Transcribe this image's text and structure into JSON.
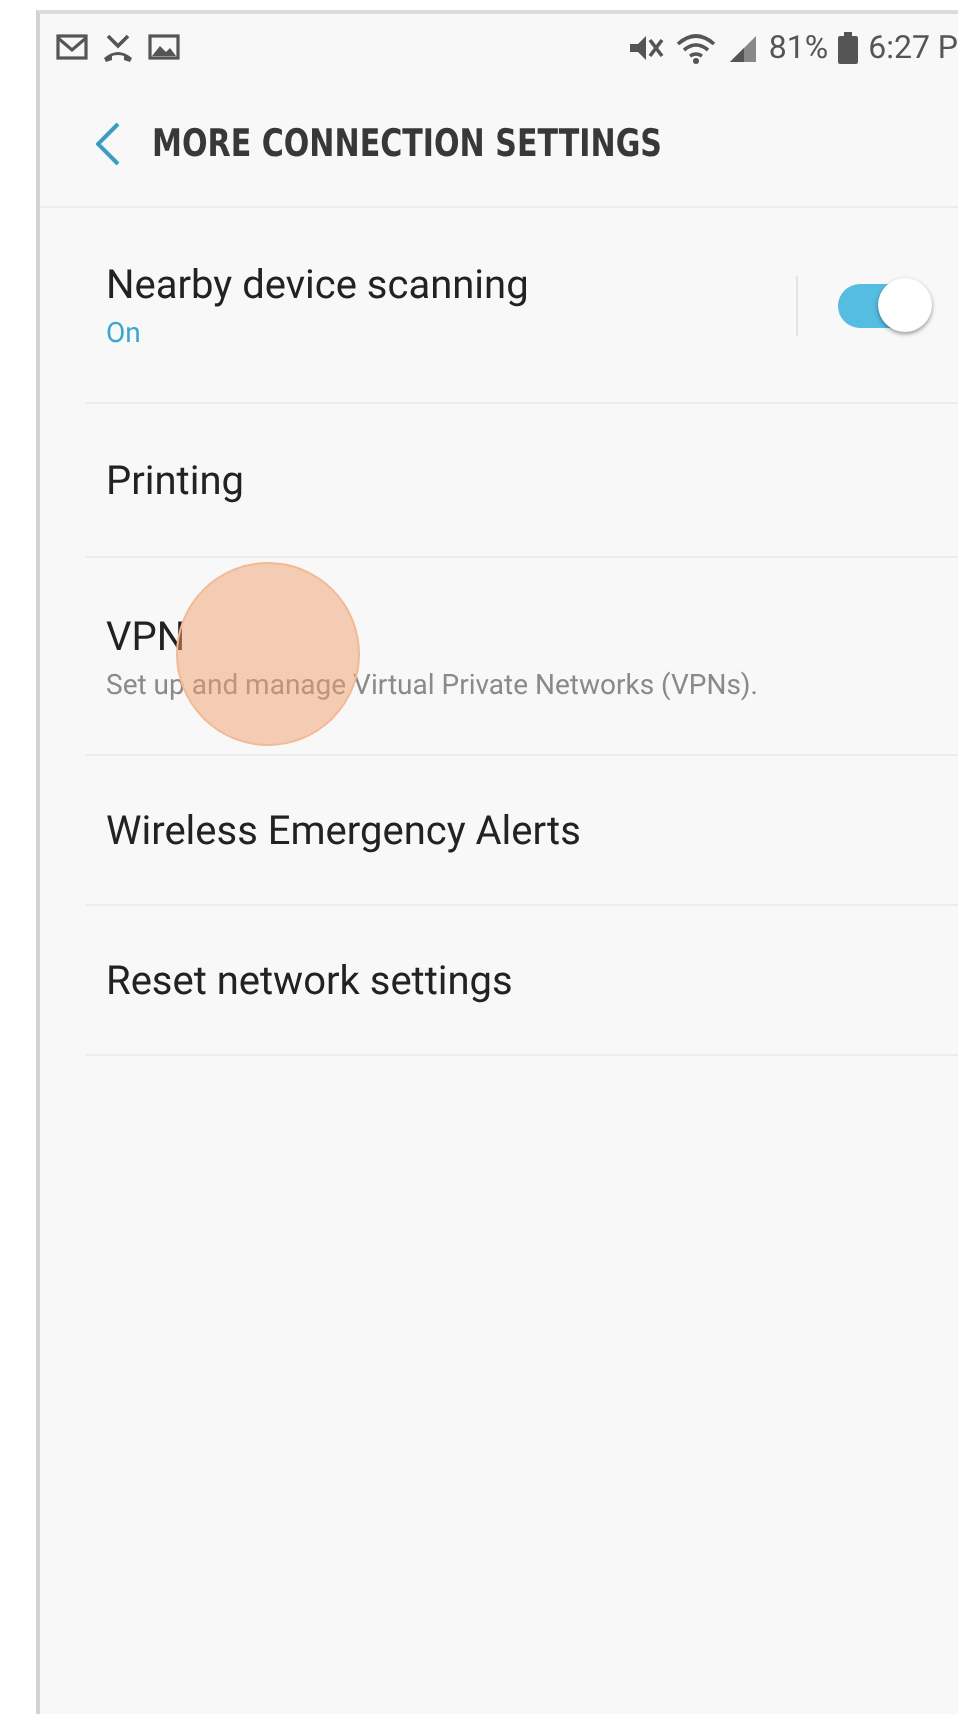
{
  "status_bar": {
    "battery": "81%",
    "time": "6:27 P"
  },
  "header": {
    "title": "MORE CONNECTION SETTINGS"
  },
  "settings": [
    {
      "kind": "toggle",
      "title": "Nearby device scanning",
      "summary": "On",
      "on": true
    },
    {
      "kind": "plain",
      "title": "Printing"
    },
    {
      "kind": "plain",
      "title": "VPN",
      "summary": "Set up and manage Virtual Private Networks (VPNs)."
    },
    {
      "kind": "plain",
      "title": "Wireless Emergency Alerts"
    },
    {
      "kind": "plain",
      "title": "Reset network settings"
    }
  ]
}
